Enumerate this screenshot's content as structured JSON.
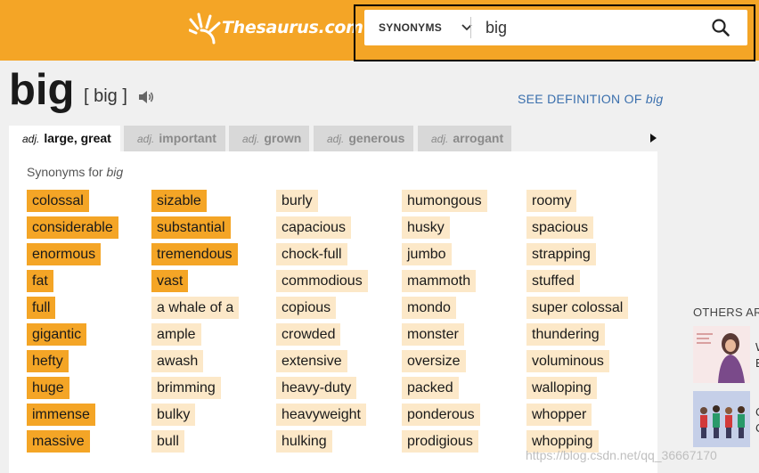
{
  "header": {
    "logo_text": "Thesaurus.com",
    "search": {
      "type_label": "SYNONYMS",
      "query": "big"
    }
  },
  "entry": {
    "word": "big",
    "pronunciation": "[ big ]",
    "see_definition_prefix": "SEE DEFINITION OF ",
    "see_definition_word": "big"
  },
  "tabs": [
    {
      "pos": "adj.",
      "label": "large, great",
      "active": true
    },
    {
      "pos": "adj.",
      "label": "important",
      "active": false
    },
    {
      "pos": "adj.",
      "label": "grown",
      "active": false
    },
    {
      "pos": "adj.",
      "label": "generous",
      "active": false
    },
    {
      "pos": "adj.",
      "label": "arrogant",
      "active": false
    }
  ],
  "synonyms": {
    "heading_prefix": "Synonyms for ",
    "heading_word": "big",
    "columns": [
      [
        {
          "text": "colossal",
          "relevance": 1
        },
        {
          "text": "considerable",
          "relevance": 1
        },
        {
          "text": "enormous",
          "relevance": 1
        },
        {
          "text": "fat",
          "relevance": 1
        },
        {
          "text": "full",
          "relevance": 1
        },
        {
          "text": "gigantic",
          "relevance": 1
        },
        {
          "text": "hefty",
          "relevance": 1
        },
        {
          "text": "huge",
          "relevance": 1
        },
        {
          "text": "immense",
          "relevance": 1
        },
        {
          "text": "massive",
          "relevance": 1
        }
      ],
      [
        {
          "text": "sizable",
          "relevance": 1
        },
        {
          "text": "substantial",
          "relevance": 1
        },
        {
          "text": "tremendous",
          "relevance": 1
        },
        {
          "text": "vast",
          "relevance": 1
        },
        {
          "text": "a whale of a",
          "relevance": 2
        },
        {
          "text": "ample",
          "relevance": 2
        },
        {
          "text": "awash",
          "relevance": 2
        },
        {
          "text": "brimming",
          "relevance": 2
        },
        {
          "text": "bulky",
          "relevance": 2
        },
        {
          "text": "bull",
          "relevance": 2
        }
      ],
      [
        {
          "text": "burly",
          "relevance": 2
        },
        {
          "text": "capacious",
          "relevance": 2
        },
        {
          "text": "chock-full",
          "relevance": 2
        },
        {
          "text": "commodious",
          "relevance": 2
        },
        {
          "text": "copious",
          "relevance": 2
        },
        {
          "text": "crowded",
          "relevance": 2
        },
        {
          "text": "extensive",
          "relevance": 2
        },
        {
          "text": "heavy-duty",
          "relevance": 2
        },
        {
          "text": "heavyweight",
          "relevance": 2
        },
        {
          "text": "hulking",
          "relevance": 2
        }
      ],
      [
        {
          "text": "humongous",
          "relevance": 2
        },
        {
          "text": "husky",
          "relevance": 2
        },
        {
          "text": "jumbo",
          "relevance": 2
        },
        {
          "text": "mammoth",
          "relevance": 2
        },
        {
          "text": "mondo",
          "relevance": 2
        },
        {
          "text": "monster",
          "relevance": 2
        },
        {
          "text": "oversize",
          "relevance": 2
        },
        {
          "text": "packed",
          "relevance": 2
        },
        {
          "text": "ponderous",
          "relevance": 2
        },
        {
          "text": "prodigious",
          "relevance": 2
        }
      ],
      [
        {
          "text": "roomy",
          "relevance": 2
        },
        {
          "text": "spacious",
          "relevance": 2
        },
        {
          "text": "strapping",
          "relevance": 2
        },
        {
          "text": "stuffed",
          "relevance": 2
        },
        {
          "text": "super colossal",
          "relevance": 2
        },
        {
          "text": "thundering",
          "relevance": 2
        },
        {
          "text": "voluminous",
          "relevance": 2
        },
        {
          "text": "walloping",
          "relevance": 2
        },
        {
          "text": "whopper",
          "relevance": 2
        },
        {
          "text": "whopping",
          "relevance": 2
        }
      ]
    ]
  },
  "sidebar": {
    "others_label": "OTHERS AR",
    "fragments": [
      "W",
      "E",
      "C",
      "C"
    ]
  },
  "watermark": "https://blog.csdn.net/qq_36667170",
  "colors": {
    "brand_orange": "#f4a526",
    "relevance_high": "#f4a526",
    "relevance_low": "#fce8c8",
    "link_blue": "#3a6fad"
  },
  "icons": {
    "logo": "sunburst-icon",
    "dropdown": "chevron-down-icon",
    "search": "search-icon",
    "audio": "speaker-icon",
    "tabs_scroll": "caret-right-icon"
  }
}
